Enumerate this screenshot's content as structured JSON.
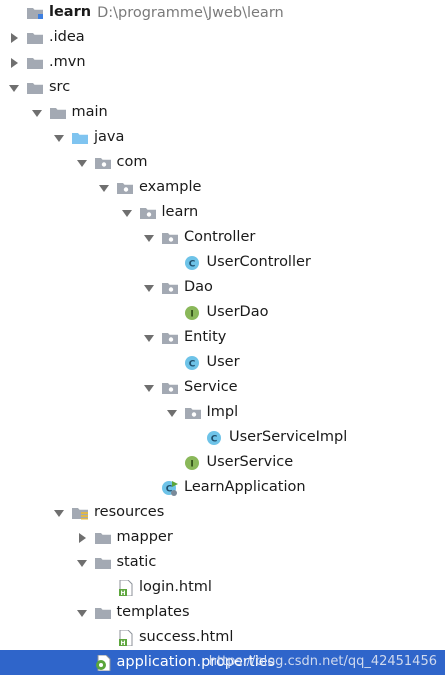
{
  "tree": [
    {
      "label": "learn",
      "path": "D:\\programme\\Jweb\\learn",
      "icon": "module-folder-icon",
      "arrow": "none",
      "depth": 0,
      "bold": true
    },
    {
      "label": ".idea",
      "icon": "folder-icon",
      "arrow": "collapsed",
      "depth": 0
    },
    {
      "label": ".mvn",
      "icon": "folder-icon",
      "arrow": "collapsed",
      "depth": 0
    },
    {
      "label": "src",
      "icon": "folder-icon",
      "arrow": "expanded",
      "depth": 0
    },
    {
      "label": "main",
      "icon": "folder-icon",
      "arrow": "expanded",
      "depth": 1
    },
    {
      "label": "java",
      "icon": "source-folder-icon",
      "arrow": "expanded",
      "depth": 2
    },
    {
      "label": "com",
      "icon": "package-icon",
      "arrow": "expanded",
      "depth": 3
    },
    {
      "label": "example",
      "icon": "package-icon",
      "arrow": "expanded",
      "depth": 4
    },
    {
      "label": "learn",
      "icon": "package-icon",
      "arrow": "expanded",
      "depth": 5
    },
    {
      "label": "Controller",
      "icon": "package-icon",
      "arrow": "expanded",
      "depth": 6
    },
    {
      "label": "UserController",
      "icon": "class-icon",
      "arrow": "none",
      "depth": 7
    },
    {
      "label": "Dao",
      "icon": "package-icon",
      "arrow": "expanded",
      "depth": 6
    },
    {
      "label": "UserDao",
      "icon": "interface-icon",
      "arrow": "none",
      "depth": 7
    },
    {
      "label": "Entity",
      "icon": "package-icon",
      "arrow": "expanded",
      "depth": 6
    },
    {
      "label": "User",
      "icon": "class-icon",
      "arrow": "none",
      "depth": 7
    },
    {
      "label": "Service",
      "icon": "package-icon",
      "arrow": "expanded",
      "depth": 6
    },
    {
      "label": "Impl",
      "icon": "package-icon",
      "arrow": "expanded",
      "depth": 7
    },
    {
      "label": "UserServiceImpl",
      "icon": "class-icon",
      "arrow": "none",
      "depth": 8
    },
    {
      "label": "UserService",
      "icon": "interface-icon",
      "arrow": "none",
      "depth": 7
    },
    {
      "label": "LearnApplication",
      "icon": "spring-boot-class-icon",
      "arrow": "none",
      "depth": 6
    },
    {
      "label": "resources",
      "icon": "resources-folder-icon",
      "arrow": "expanded",
      "depth": 2
    },
    {
      "label": "mapper",
      "icon": "folder-icon",
      "arrow": "collapsed",
      "depth": 3
    },
    {
      "label": "static",
      "icon": "folder-icon",
      "arrow": "expanded",
      "depth": 3
    },
    {
      "label": "login.html",
      "icon": "html-file-icon",
      "arrow": "none",
      "depth": 4
    },
    {
      "label": "templates",
      "icon": "folder-icon",
      "arrow": "expanded",
      "depth": 3
    },
    {
      "label": "success.html",
      "icon": "html-file-icon",
      "arrow": "none",
      "depth": 4
    },
    {
      "label": "application.properties",
      "icon": "properties-file-icon",
      "arrow": "none",
      "depth": 3,
      "selected": true
    }
  ],
  "watermark": "https://blog.csdn.net/qq_42451456",
  "colors": {
    "selection": "#2f65ca",
    "folder": "#a0a7b0",
    "class": "#6ec3e8",
    "interface": "#8ab85a"
  }
}
